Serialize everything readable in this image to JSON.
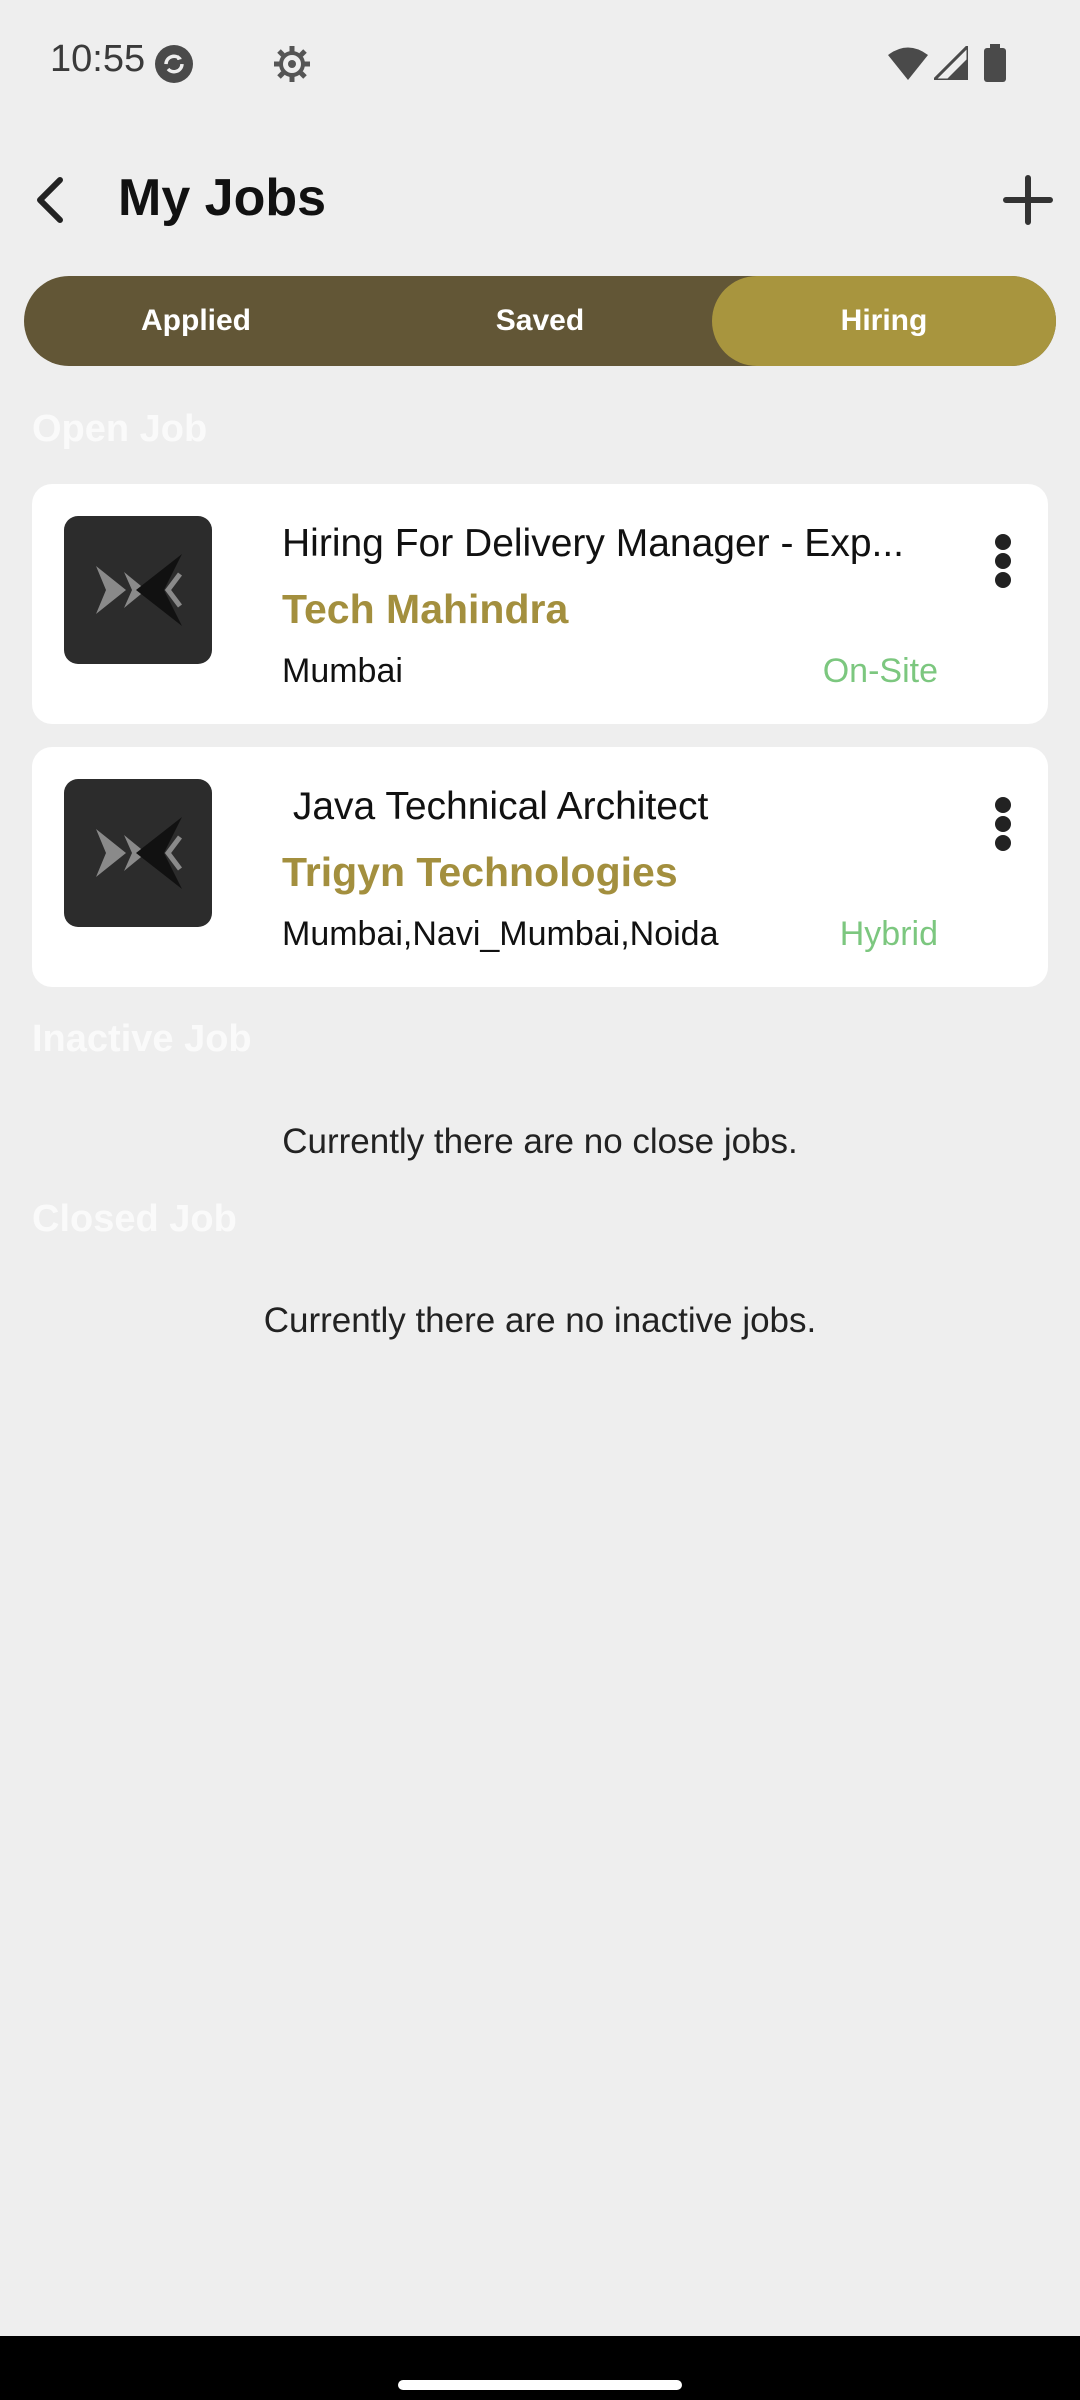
{
  "status_bar": {
    "time": "10:55",
    "icons": [
      "sync-icon",
      "gear-icon",
      "wifi-icon",
      "signal-icon",
      "battery-icon"
    ]
  },
  "header": {
    "title": "My Jobs",
    "back_icon": "back-arrow-icon",
    "add_icon": "plus-icon"
  },
  "tabs": [
    {
      "label": "Applied",
      "selected": false
    },
    {
      "label": "Saved",
      "selected": false
    },
    {
      "label": "Hiring",
      "selected": true
    }
  ],
  "colors": {
    "tab_bar": "#625636",
    "tab_selected": "#a8953e",
    "company": "#a38f3e",
    "work_mode": "#7cc77f",
    "background": "#eeeeee"
  },
  "sections": {
    "open": {
      "title": "Open Job",
      "jobs": [
        {
          "title": "Hiring For Delivery Manager - Exp...",
          "company": "Tech Mahindra",
          "location": "Mumbai",
          "mode": "On-Site"
        },
        {
          "title": " Java Technical Architect",
          "company": "Trigyn Technologies",
          "location": "Mumbai,Navi_Mumbai,Noida",
          "mode": "Hybrid"
        }
      ]
    },
    "inactive": {
      "title": "Inactive Job",
      "empty_message": "Currently there are no close jobs."
    },
    "closed": {
      "title": "Closed Job",
      "empty_message": "Currently there are no inactive jobs."
    }
  }
}
